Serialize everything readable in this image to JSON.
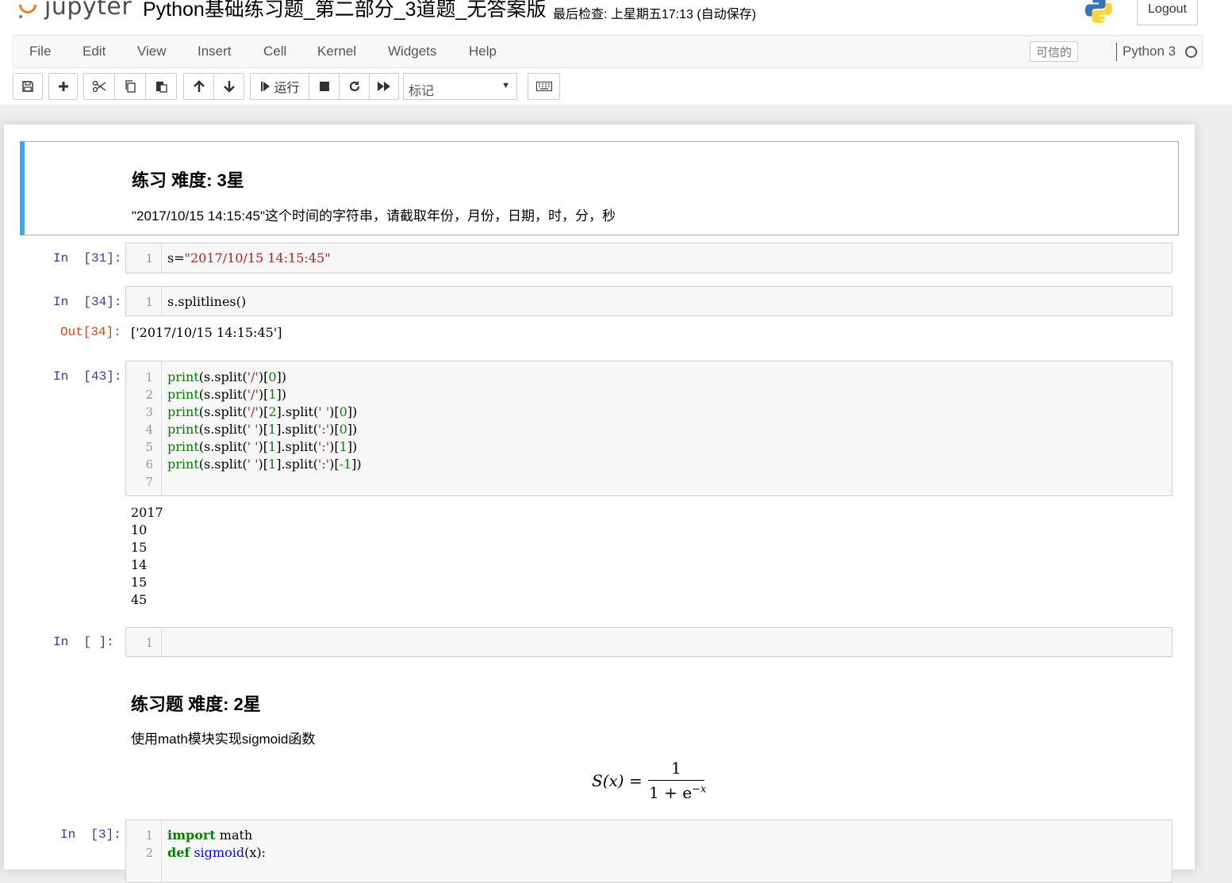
{
  "header": {
    "logo_text": "jupyter",
    "notebook_title": "Python基础练习题_第二部分_3道题_无答案版",
    "checkpoint": "最后检查: 上星期五17:13  (自动保存)",
    "logout": "Logout"
  },
  "menubar": {
    "items": [
      "File",
      "Edit",
      "View",
      "Insert",
      "Cell",
      "Kernel",
      "Widgets",
      "Help"
    ],
    "trusted": "可信的",
    "kernel": "Python 3"
  },
  "toolbar": {
    "run_label": "运行",
    "cell_type": "标记"
  },
  "cells": {
    "md1": {
      "heading": "练习 难度: 3星",
      "text": "\"2017/10/15 14:15:45\"这个时间的字符串，请截取年份，月份，日期，时，分，秒"
    },
    "c31": {
      "prompt": "In  [31]:",
      "lines": [
        "1"
      ]
    },
    "c34": {
      "prompt": "In  [34]:",
      "out_prompt": "Out[34]:",
      "output": "['2017/10/15 14:15:45']"
    },
    "c43": {
      "prompt": "In  [43]:",
      "lnums": [
        "1",
        "2",
        "3",
        "4",
        "5",
        "6",
        "7"
      ],
      "outputs": [
        "2017",
        "10",
        "15",
        "14",
        "15",
        "45"
      ]
    },
    "empty": {
      "prompt": "In  [ ]:",
      "lnum": "1"
    },
    "md2": {
      "heading": "练习题 难度: 2星",
      "text": "使用math模块实现sigmoid函数",
      "formula_lhs": "S(x) =",
      "formula_num": "1",
      "formula_den": "1 + e",
      "formula_exp": "−x"
    },
    "c3": {
      "prompt": "In  [3]:",
      "lnums": [
        "1",
        "2"
      ]
    }
  },
  "colors": {
    "in_prompt": "#303f9f",
    "out_prompt": "#d84315",
    "selected_cell_bar": "#42a5f5"
  }
}
